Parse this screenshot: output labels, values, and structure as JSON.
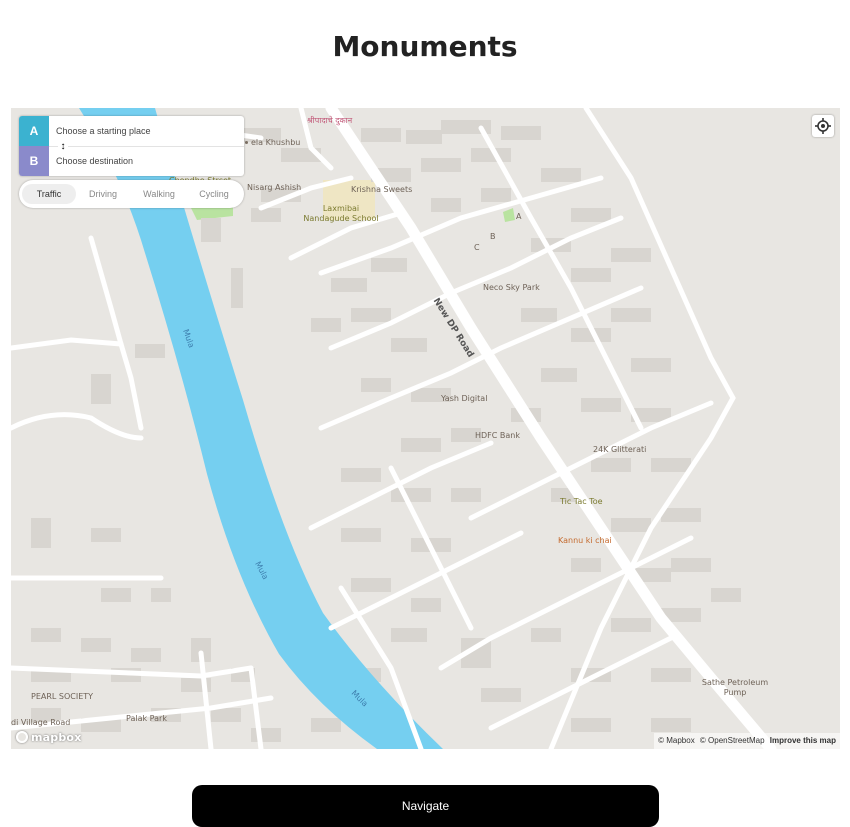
{
  "page": {
    "title": "Monuments"
  },
  "directions": {
    "origin_badge": "A",
    "destination_badge": "B",
    "origin_placeholder": "Choose a starting place",
    "destination_placeholder": "Choose destination",
    "reverse_icon": "↕",
    "modes": [
      "Traffic",
      "Driving",
      "Walking",
      "Cycling"
    ],
    "active_mode": "Traffic",
    "accent_a": "#3bb2d0",
    "accent_b": "#8a8acb"
  },
  "map": {
    "labels": {
      "shop_top": "श्रीपादाचे दुकान",
      "shop_left": "ela Khushbu",
      "chondhe_street": "Chondhe Strcet",
      "nisarg": "Nisarg Ashish",
      "krishna": "Krishna Sweets",
      "school_1": "Laxmibai",
      "school_2": "Nandagude School",
      "a": "A",
      "b": "B",
      "c": "C",
      "neco": "Neco Sky Park",
      "road": "New DP Road",
      "yash": "Yash Digital",
      "hdfc": "HDFC Bank",
      "glitterati": "24K Glitterati",
      "tictac": "Tic Tac Toe",
      "kannu": "Kannu ki chai",
      "sathe_1": "Sathe Petroleum",
      "sathe_2": "Pump",
      "pearl": "PEARL SOCIETY",
      "palak": "Palak Park",
      "village": "di Village Road"
    },
    "river": "Mula",
    "colors": {
      "land": "#e8e6e2",
      "water": "#75cff0",
      "road": "#ffffff",
      "building": "#d8d5d0",
      "park": "#b9e3a0"
    }
  },
  "attribution": {
    "logo": "mapbox",
    "mapbox": "© Mapbox",
    "osm": "© OpenStreetMap",
    "improve": "Improve this map"
  },
  "navigate_button": "Navigate"
}
